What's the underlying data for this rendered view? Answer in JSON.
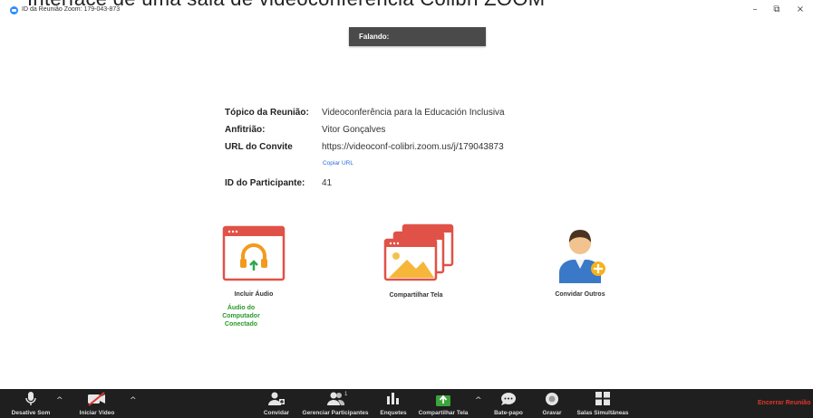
{
  "caption": "Interface de uma sala de videoconferência Colibri ZOOM",
  "window": {
    "title": "ID da Reunião Zoom: 179-043-873",
    "minimize": "–",
    "restore": "⧉",
    "close": "×"
  },
  "speaking": {
    "label": "Falando:"
  },
  "meeting_info": {
    "topic_label": "Tópico da Reunião:",
    "topic_value": "Videoconferência para la Educación Inclusiva",
    "host_label": "Anfitrião:",
    "host_value": "Vitor Gonçalves",
    "url_label": "URL do Convite",
    "url_value": "https://videoconf-colibri.zoom.us/j/179043873",
    "copy_url": "Copiar URL",
    "participant_label": "ID do Participante:",
    "participant_value": "41"
  },
  "actions": {
    "audio_label": "Incluir Áudio",
    "audio_status": "Áudio do Computador Conectado",
    "share_label": "Compartilhar Tela",
    "invite_label": "Convidar Outros"
  },
  "toolbar": {
    "mute": "Desative Som",
    "video": "Iniciar Vídeo",
    "invite": "Convidar",
    "participants": "Gerenciar Participantes",
    "participants_count": "1",
    "polls": "Enquetes",
    "share": "Compartilhar Tela",
    "chat": "Bate-papo",
    "record": "Gravar",
    "breakout": "Salas Simultâneas",
    "end": "Encerrar Reunião"
  },
  "colors": {
    "accent_red": "#e0352b",
    "audio_green": "#2a9a2a",
    "share_green": "#3aa53a",
    "toolbar_bg": "#1f1f1f",
    "link_blue": "#2d6cd6"
  }
}
